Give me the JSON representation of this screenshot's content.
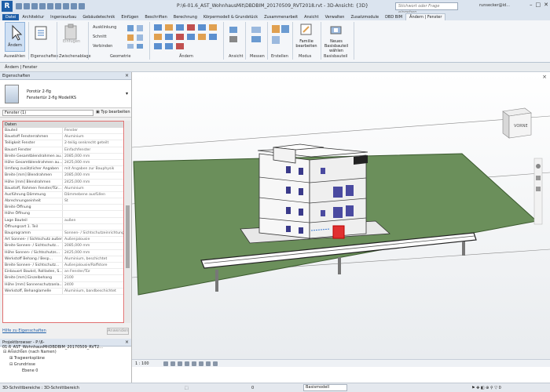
{
  "titlebar": {
    "logo": "R",
    "title": "P:\\6-01.6_AST_WohnhausMit\\DBDBIM_20170509_RVT2018.rvt - 3D-Ansicht: {3D}",
    "search_placeholder": "Stichwort oder Frage eingeben",
    "user": "runsecker@id...",
    "window_buttons": [
      "–",
      "□",
      "✕"
    ]
  },
  "ribbon_tabs": [
    "Datei",
    "Architektur",
    "Ingenieurbau",
    "Gebäudetechnik",
    "Einfügen",
    "Beschriften",
    "Berechnung",
    "Körpermodell & Grundstück",
    "Zusammenarbeit",
    "Ansicht",
    "Verwalten",
    "Zusatzmodule",
    "DBD BIM",
    "Ändern | Fenster"
  ],
  "active_tab_index": 13,
  "ribbon": {
    "modify_label": "Ändern",
    "select_label": "Auswählen",
    "properties_label": "Eigenschaften",
    "paste_label": "Einfügen",
    "clipboard_label": "Zwischenablage",
    "geometry_items": [
      "Ausklinkung",
      "Schnitt",
      "Verbinden"
    ],
    "geometry_label": "Geometrie",
    "modify_panel_label": "Ändern",
    "view_label": "Ansicht",
    "measure_label": "Messen",
    "create_label": "Erstellen",
    "mode_button": "Familie bearbeiten",
    "mode_label": "Modus",
    "new_element_button": "Neues Basisbauteil wählen",
    "new_element_label": "Basisbauteil"
  },
  "optionsbar": {
    "text": "Ändern | Fenster"
  },
  "properties": {
    "title": "Eigenschaften",
    "type_line1": "Porotür 2-flg",
    "type_line2": "Fenstertür 2-flg ModellKS",
    "filter": "Fenster (1)",
    "edit_type": "Typ bearbeiten",
    "group": "Daten",
    "rows": [
      [
        "Bauteil",
        "Fenster"
      ],
      [
        "Baustoff Fensterrahmen",
        "Aluminium"
      ],
      [
        "Teiligkeit Fenster",
        "2-teilig senkrecht geteilt"
      ],
      [
        "Bauart Fenster",
        "Einfachfenster"
      ],
      [
        "Breite Gesamtblendrahmen au...",
        "2085,000 mm"
      ],
      [
        "Höhe Gesamtblendrahmen au...",
        "2425,000 mm"
      ],
      [
        "Umfang zusätzlicher Angaben",
        "mit Angaben zur Bauphysik"
      ],
      [
        "Breite [mm] Blendrahmen",
        "2085,000 mm"
      ],
      [
        "Höhe [mm] Blendrahmen",
        "2425,000 mm"
      ],
      [
        "Baustoff, Rahmen Fenster/Tür...",
        "Aluminium"
      ],
      [
        "Ausführung Dämmung",
        "Dämmebene ausfüllen"
      ],
      [
        "Abrechnungseinheit",
        "St"
      ],
      [
        "Breite Öffnung",
        ""
      ],
      [
        "Höhe Öffnung",
        ""
      ],
      [
        "Lage Bauteil",
        "außen"
      ],
      [
        "Öffnungsart 1. Teil",
        ""
      ],
      [
        "Bauprogramm",
        "Sonnen- / Sichtschutzeinrichtung"
      ],
      [
        "Art Sonnen- / Sichtschutz außen",
        "Außenjalousie"
      ],
      [
        "Breite Sonnen- / Sichtschutz...",
        "2085,000 mm"
      ],
      [
        "Höhe Sonnen- / Sichtschutzs...",
        "2425,000 mm"
      ],
      [
        "Werkstoff Behang / Besp...",
        "Aluminium, beschichtet"
      ],
      [
        "Breite Sonnen- / Sichtschutz...",
        "Außenjalousie/Raffstore"
      ],
      [
        "Einbauort Baukst, Rollladen, S...",
        "an Fenster/Tür"
      ],
      [
        "Breite [mm] Einzelbehang",
        "2100"
      ],
      [
        "Höhe [mm] Sonnenschutzanla...",
        "2400"
      ],
      [
        "Werkstoff, Behanglamelle",
        "Aluminium, bandbeschichtet"
      ]
    ],
    "help_link": "Hilfe zu Eigenschaften",
    "apply": "Anwenden"
  },
  "browser": {
    "title": "Projektbrowser - P:\\6-01.6_AST_WohnhausMitDBDBIM_20170509_RVT2...",
    "items": [
      "Ansichten (nach Namen)",
      "Tragwerkspläne",
      "Grundrisse",
      "Ebene 0"
    ]
  },
  "viewbar": {
    "scale": "1 : 100"
  },
  "statusbar": {
    "left": "3D-Schnittbereiche : 3D-Schnittbereich",
    "model": "Basismodell",
    "zoom": "0"
  },
  "viewcube": {
    "label": "VORNE"
  },
  "colors": {
    "ribbon_bg": "#f4f6f9",
    "title_bg": "#dbe4ef",
    "file_tab": "#1f5fa8",
    "site_green": "#6b8f5b",
    "selected_window": "#e03030"
  }
}
